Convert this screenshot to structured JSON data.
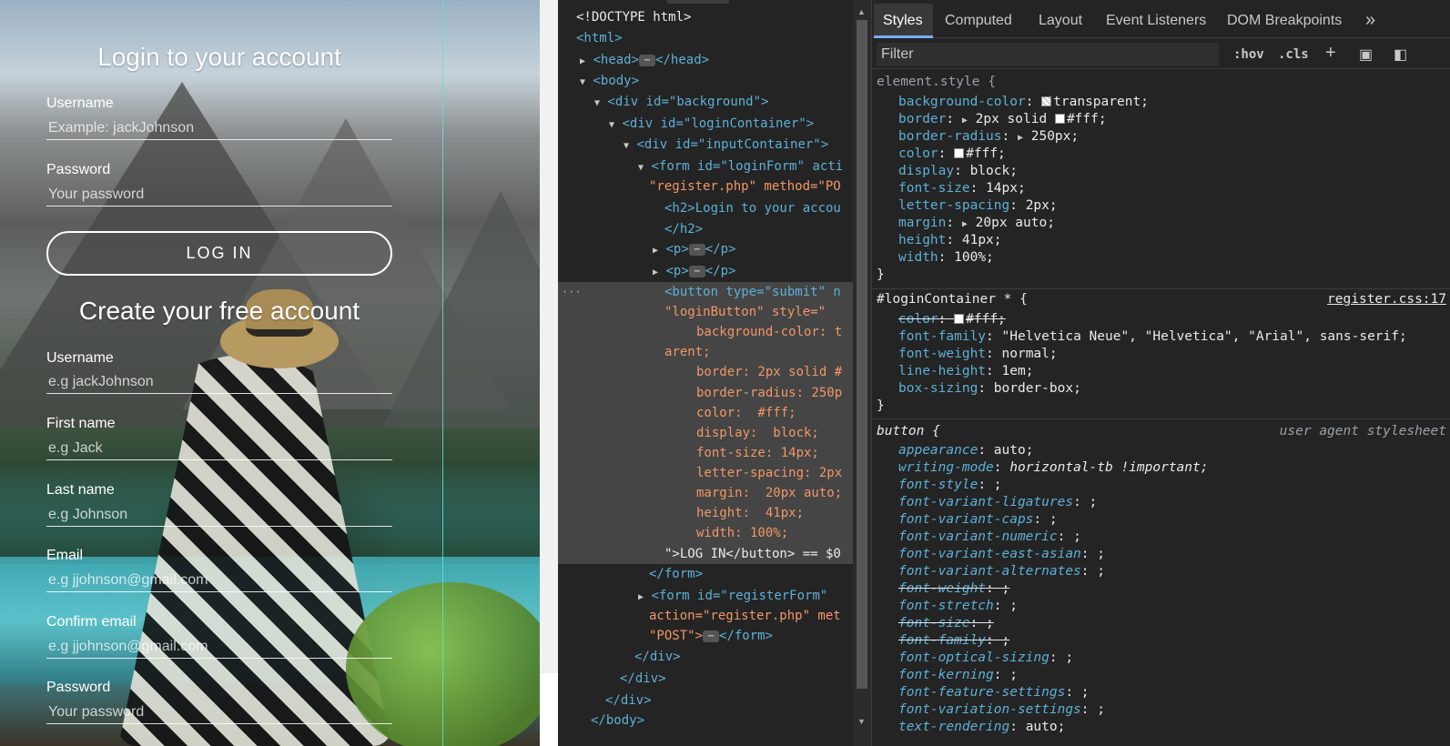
{
  "page": {
    "login_title": "Login to your account",
    "login_username_label": "Username",
    "login_username_placeholder": "Example: jackJohnson",
    "login_password_label": "Password",
    "login_password_placeholder": "Your password",
    "login_button": "LOG IN",
    "register_title": "Create your free account",
    "reg_username_label": "Username",
    "reg_username_placeholder": "e.g jackJohnson",
    "reg_firstname_label": "First name",
    "reg_firstname_placeholder": "e.g Jack",
    "reg_lastname_label": "Last name",
    "reg_lastname_placeholder": "e.g Johnson",
    "reg_email_label": "Email",
    "reg_email_placeholder": "e.g jjohnson@gmail.com",
    "reg_confirm_label": "Confirm email",
    "reg_confirm_placeholder": "e.g jjohnson@gmail.com",
    "reg_password_label": "Password",
    "reg_password_placeholder": "Your password"
  },
  "elements_panel": {
    "lines": [
      "<!DOCTYPE html>",
      "<html>",
      "<head>",
      "</head>",
      "<body>",
      "<div id=\"background\">",
      "<div id=\"loginContainer\">",
      "<div id=\"inputContainer\">",
      "<form id=\"loginForm\" acti",
      "\"register.php\" method=\"PO",
      "<h2>Login to your accou",
      "</h2>",
      "<p>",
      "</p>",
      "<button type=\"submit\" n",
      "\"loginButton\" style=\"",
      "background-color: t",
      "arent;",
      "border: 2px solid #",
      "border-radius: 250p",
      "color:  #fff;",
      "display:  block;",
      "font-size: 14px;",
      "letter-spacing: 2px",
      "margin:  20px auto;",
      "height:  41px;",
      "width: 100%;",
      "\">LOG IN</button> == $0",
      "</form>",
      "<form id=\"registerForm\"",
      "action=\"register.php\" met",
      "\"POST\">",
      "</form>",
      "</div>",
      "</body>"
    ],
    "ellipsis": "⋯"
  },
  "styles_panel": {
    "tabs": [
      "Styles",
      "Computed",
      "Layout",
      "Event Listeners",
      "DOM Breakpoints",
      "»"
    ],
    "active_tab": "Styles",
    "filter_placeholder": "Filter",
    "hov": ":hov",
    "cls": ".cls",
    "element_style": {
      "selector": "element.style {",
      "props": [
        [
          "background-color",
          "transparent;"
        ],
        [
          "border",
          "2px solid #fff;"
        ],
        [
          "border-radius",
          "250px;"
        ],
        [
          "color",
          "#fff;"
        ],
        [
          "display",
          "block;"
        ],
        [
          "font-size",
          "14px;"
        ],
        [
          "letter-spacing",
          "2px;"
        ],
        [
          "margin",
          "20px auto;"
        ],
        [
          "height",
          "41px;"
        ],
        [
          "width",
          "100%;"
        ]
      ]
    },
    "login_container_rule": {
      "selector": "#loginContainer * {",
      "source": "register.css:17",
      "props": [
        [
          "color",
          "#fff;"
        ],
        [
          "font-family",
          "\"Helvetica Neue\", \"Helvetica\", \"Arial\", sans-serif;"
        ],
        [
          "font-weight",
          "normal;"
        ],
        [
          "line-height",
          "1em;"
        ],
        [
          "box-sizing",
          "border-box;"
        ]
      ]
    },
    "ua_rule": {
      "selector": "button {",
      "source": "user agent stylesheet",
      "props": [
        [
          "appearance",
          "auto;"
        ],
        [
          "writing-mode",
          "horizontal-tb !important;"
        ],
        [
          "font-style",
          ";"
        ],
        [
          "font-variant-ligatures",
          ";"
        ],
        [
          "font-variant-caps",
          ";"
        ],
        [
          "font-variant-numeric",
          ";"
        ],
        [
          "font-variant-east-asian",
          ";"
        ],
        [
          "font-variant-alternates",
          ";"
        ],
        [
          "font-weight",
          ";"
        ],
        [
          "font-stretch",
          ";"
        ],
        [
          "font-size",
          ";"
        ],
        [
          "font-family",
          ";"
        ],
        [
          "font-optical-sizing",
          ";"
        ],
        [
          "font-kerning",
          ";"
        ],
        [
          "font-feature-settings",
          ";"
        ],
        [
          "font-variation-settings",
          ";"
        ],
        [
          "text-rendering",
          "auto;"
        ]
      ]
    },
    "close_brace": "}"
  },
  "colors": {
    "accent": "#7cacf8",
    "tag": "#5db0d7",
    "value": "#f29766",
    "panel_bg": "#242424"
  }
}
